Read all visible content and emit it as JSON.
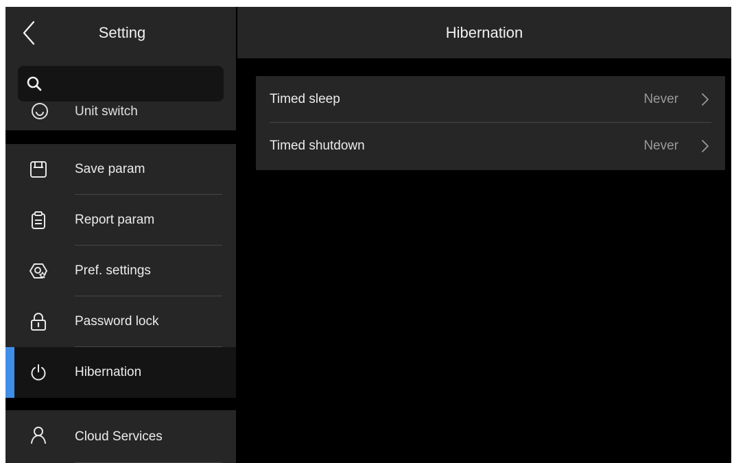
{
  "sidebar": {
    "title": "Setting",
    "search": {
      "placeholder": "",
      "value": ""
    },
    "partial_item": {
      "label": "Unit switch",
      "icon": "unit-switch-icon"
    },
    "items": [
      {
        "label": "Save param",
        "icon": "save-icon"
      },
      {
        "label": "Report param",
        "icon": "clipboard-icon"
      },
      {
        "label": "Pref. settings",
        "icon": "preference-gear-icon"
      },
      {
        "label": "Password lock",
        "icon": "lock-icon"
      },
      {
        "label": "Hibernation",
        "icon": "power-icon",
        "active": true
      },
      {
        "label": "Cloud Services",
        "icon": "user-icon"
      }
    ]
  },
  "main": {
    "title": "Hibernation",
    "rows": [
      {
        "label": "Timed sleep",
        "value": "Never"
      },
      {
        "label": "Timed shutdown",
        "value": "Never"
      }
    ]
  },
  "colors": {
    "background": "#000000",
    "panel": "#262626",
    "active_row": "#141414",
    "accent": "#3f8ee8",
    "value_text": "#9a9a9a"
  }
}
